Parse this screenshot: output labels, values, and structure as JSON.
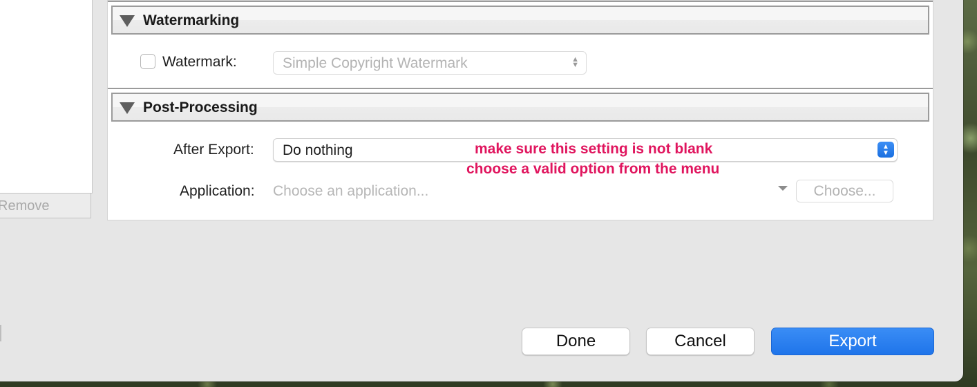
{
  "left_pane": {
    "remove_label": "Remove"
  },
  "watermarking": {
    "title": "Watermarking",
    "checkbox_label": "Watermark:",
    "checked": false,
    "preset_value": "Simple Copyright Watermark"
  },
  "post_processing": {
    "title": "Post-Processing",
    "after_export_label": "After Export:",
    "after_export_value": "Do nothing",
    "application_label": "Application:",
    "application_placeholder": "Choose an application...",
    "choose_label": "Choose..."
  },
  "annotation": {
    "line1": "make sure this setting is not blank",
    "line2": "choose a valid option from the menu",
    "color": "#e0155e"
  },
  "footer": {
    "done_label": "Done",
    "cancel_label": "Cancel",
    "export_label": "Export"
  },
  "colors": {
    "accent": "#1f74ea",
    "dialog_bg": "#e6e6e6"
  }
}
